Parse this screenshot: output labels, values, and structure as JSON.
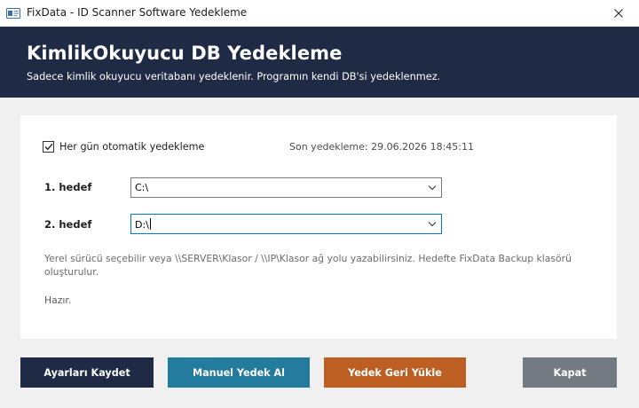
{
  "window": {
    "title": "FixData - ID Scanner Software Yedekleme",
    "close_icon": "close-icon"
  },
  "header": {
    "title": "KimlikOkuyucu DB Yedekleme",
    "subtitle": "Sadece kimlik okuyucu veritabanı yedeklenir. Programın kendi DB'si yedeklenmez.",
    "background": "#1f2a44"
  },
  "settings": {
    "auto_backup": {
      "label": "Her gün otomatik yedekleme",
      "checked": true
    },
    "last_backup": "Son yedekleme: 29.06.2026 18:45:11",
    "target1": {
      "label": "1. hedef",
      "value": "C:\\"
    },
    "target2": {
      "label": "2. hedef",
      "value": "D:\\"
    },
    "hint": "Yerel sürücü seçebilir veya \\\\SERVER\\Klasor / \\\\IP\\Klasor ağ yolu yazabilirsiniz. Hedefte FixData Backup klasörü oluşturulur.",
    "status": "Hazır."
  },
  "buttons": {
    "save": "Ayarları Kaydet",
    "manual": "Manuel Yedek Al",
    "restore": "Yedek Geri Yükle",
    "close": "Kapat"
  },
  "colors": {
    "save": "#1f2a44",
    "manual": "#237b9e",
    "restore": "#bd5f22",
    "close": "#747a82",
    "focus": "#0078d7"
  }
}
